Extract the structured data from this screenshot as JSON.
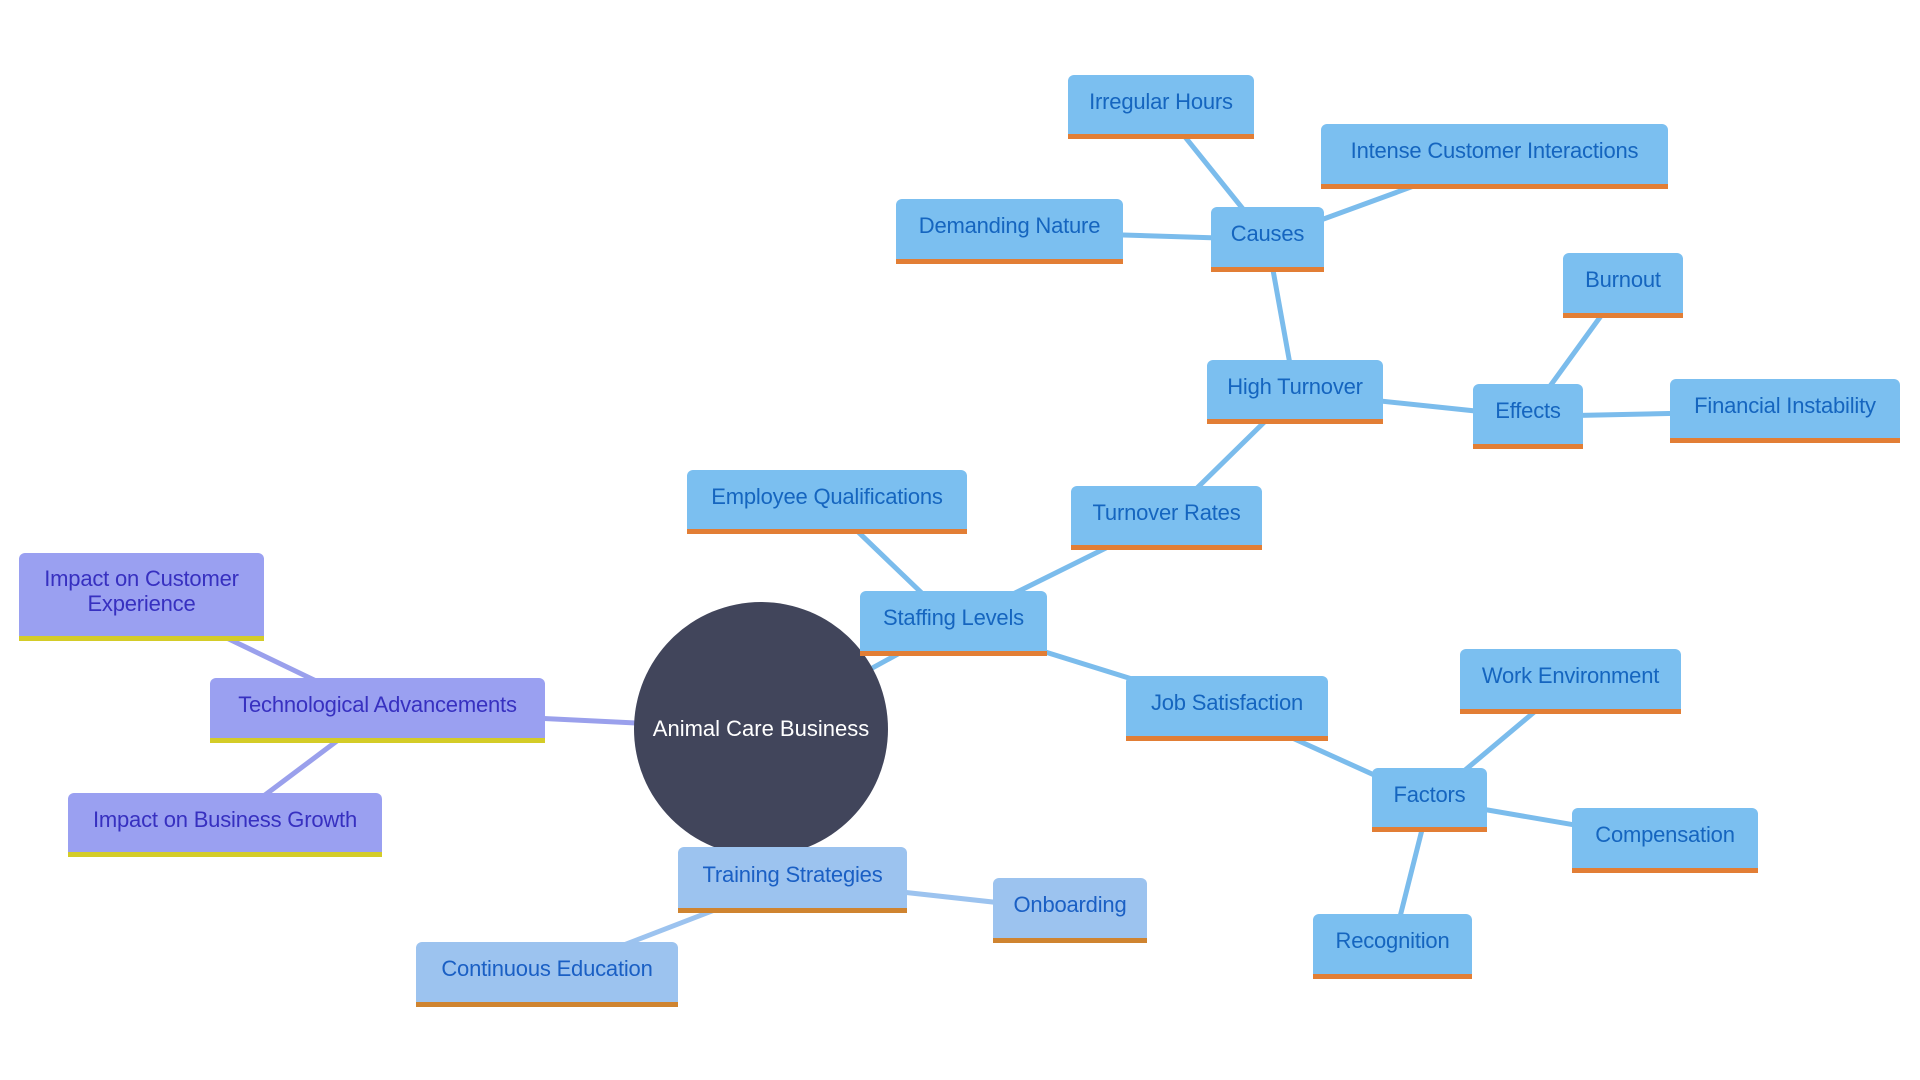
{
  "diagram": {
    "type": "mindmap",
    "root": {
      "id": "root",
      "label": "Animal Care Business"
    },
    "colors": {
      "root_fill": "#41455b",
      "root_text": "#ffffff",
      "blue_fill": "#7bbff0",
      "blue_text": "#1565bf",
      "blue_underline": "#e27e35",
      "blue_edge": "#7bbcec",
      "light_fill": "#9cc3ef",
      "light_text": "#1a5fc4",
      "light_underline": "#cf8430",
      "light_edge": "#9cc3ef",
      "purple_fill": "#9aa0f1",
      "purple_text": "#3730c0",
      "purple_underline": "#d4cc28",
      "purple_edge": "#9aa0ec"
    },
    "nodes": [
      {
        "id": "staffing",
        "label": "Staffing Levels",
        "parent": "root",
        "theme": "blue"
      },
      {
        "id": "qualifications",
        "label": "Employee Qualifications",
        "parent": "staffing",
        "theme": "blue"
      },
      {
        "id": "turnover_rates",
        "label": "Turnover Rates",
        "parent": "staffing",
        "theme": "blue"
      },
      {
        "id": "high_turnover",
        "label": "High Turnover",
        "parent": "turnover_rates",
        "theme": "blue"
      },
      {
        "id": "causes",
        "label": "Causes",
        "parent": "high_turnover",
        "theme": "blue"
      },
      {
        "id": "irregular",
        "label": "Irregular Hours",
        "parent": "causes",
        "theme": "blue"
      },
      {
        "id": "intense",
        "label": "Intense Customer Interactions",
        "parent": "causes",
        "theme": "blue"
      },
      {
        "id": "demanding",
        "label": "Demanding Nature",
        "parent": "causes",
        "theme": "blue"
      },
      {
        "id": "effects",
        "label": "Effects",
        "parent": "high_turnover",
        "theme": "blue"
      },
      {
        "id": "burnout",
        "label": "Burnout",
        "parent": "effects",
        "theme": "blue"
      },
      {
        "id": "financial",
        "label": "Financial Instability",
        "parent": "effects",
        "theme": "blue"
      },
      {
        "id": "job_sat",
        "label": "Job Satisfaction",
        "parent": "staffing",
        "theme": "blue"
      },
      {
        "id": "factors",
        "label": "Factors",
        "parent": "job_sat",
        "theme": "blue"
      },
      {
        "id": "work_env",
        "label": "Work Environment",
        "parent": "factors",
        "theme": "blue"
      },
      {
        "id": "compensation",
        "label": "Compensation",
        "parent": "factors",
        "theme": "blue"
      },
      {
        "id": "recognition",
        "label": "Recognition",
        "parent": "factors",
        "theme": "blue"
      },
      {
        "id": "training",
        "label": "Training Strategies",
        "parent": "root",
        "theme": "light"
      },
      {
        "id": "onboarding",
        "label": "Onboarding",
        "parent": "training",
        "theme": "light"
      },
      {
        "id": "continuous",
        "label": "Continuous Education",
        "parent": "training",
        "theme": "light"
      },
      {
        "id": "tech",
        "label": "Technological Advancements",
        "parent": "root",
        "theme": "purple"
      },
      {
        "id": "customer_exp",
        "label": "Impact on Customer Experience",
        "parent": "tech",
        "theme": "purple"
      },
      {
        "id": "business_growth",
        "label": "Impact on Business Growth",
        "parent": "tech",
        "theme": "purple"
      }
    ]
  }
}
